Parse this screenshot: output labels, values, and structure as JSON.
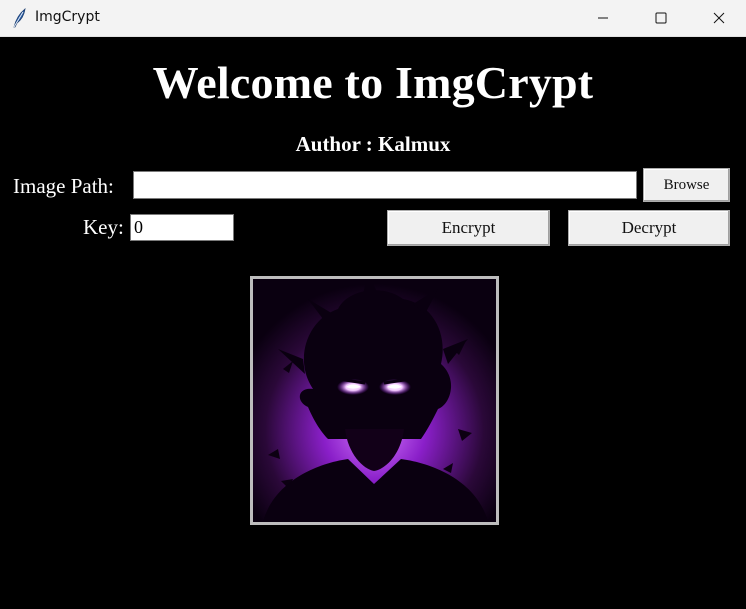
{
  "window": {
    "title": "ImgCrypt",
    "icon": "feather-icon",
    "controls": [
      "minimize-icon",
      "maximize-icon",
      "close-icon"
    ]
  },
  "main": {
    "heading": "Welcome to ImgCrypt",
    "author": "Author : Kalmux",
    "image_path_label": "Image Path:",
    "image_path_value": "",
    "browse_label": "Browse",
    "key_label": "Key:",
    "key_value": "0",
    "encrypt_label": "Encrypt",
    "decrypt_label": "Decrypt"
  },
  "colors": {
    "background": "#000000",
    "text": "#ffffff",
    "button_face": "#f0f0f0",
    "image_accent": "#b23cff"
  }
}
